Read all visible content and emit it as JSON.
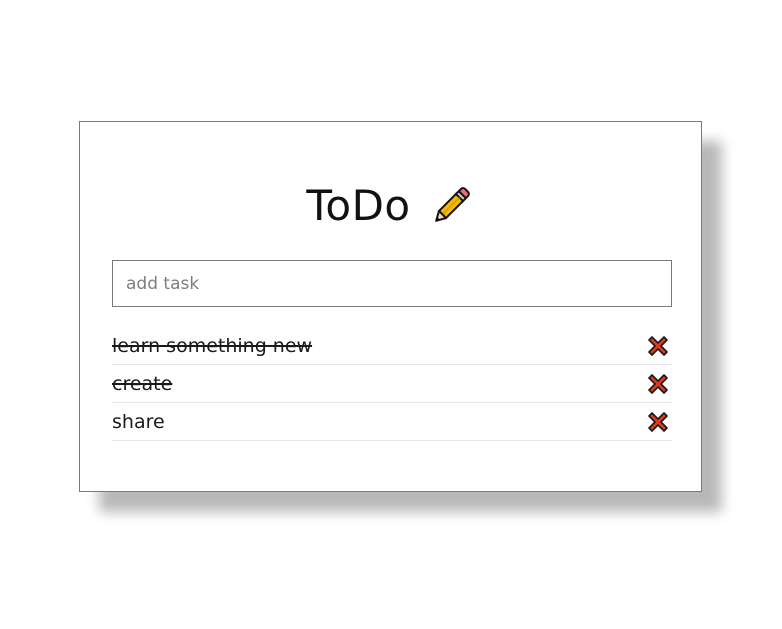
{
  "app": {
    "title": "ToDo",
    "title_icon": "pencil-icon"
  },
  "input": {
    "placeholder": "add task",
    "value": ""
  },
  "tasks": [
    {
      "label": "learn something new",
      "completed": true,
      "delete_icon": "close-icon"
    },
    {
      "label": "create",
      "completed": true,
      "delete_icon": "close-icon"
    },
    {
      "label": "share",
      "completed": false,
      "delete_icon": "close-icon"
    }
  ],
  "colors": {
    "delete_icon": "#e0391d",
    "pencil_body": "#f5b800",
    "pencil_eraser": "#ef6a7a"
  }
}
